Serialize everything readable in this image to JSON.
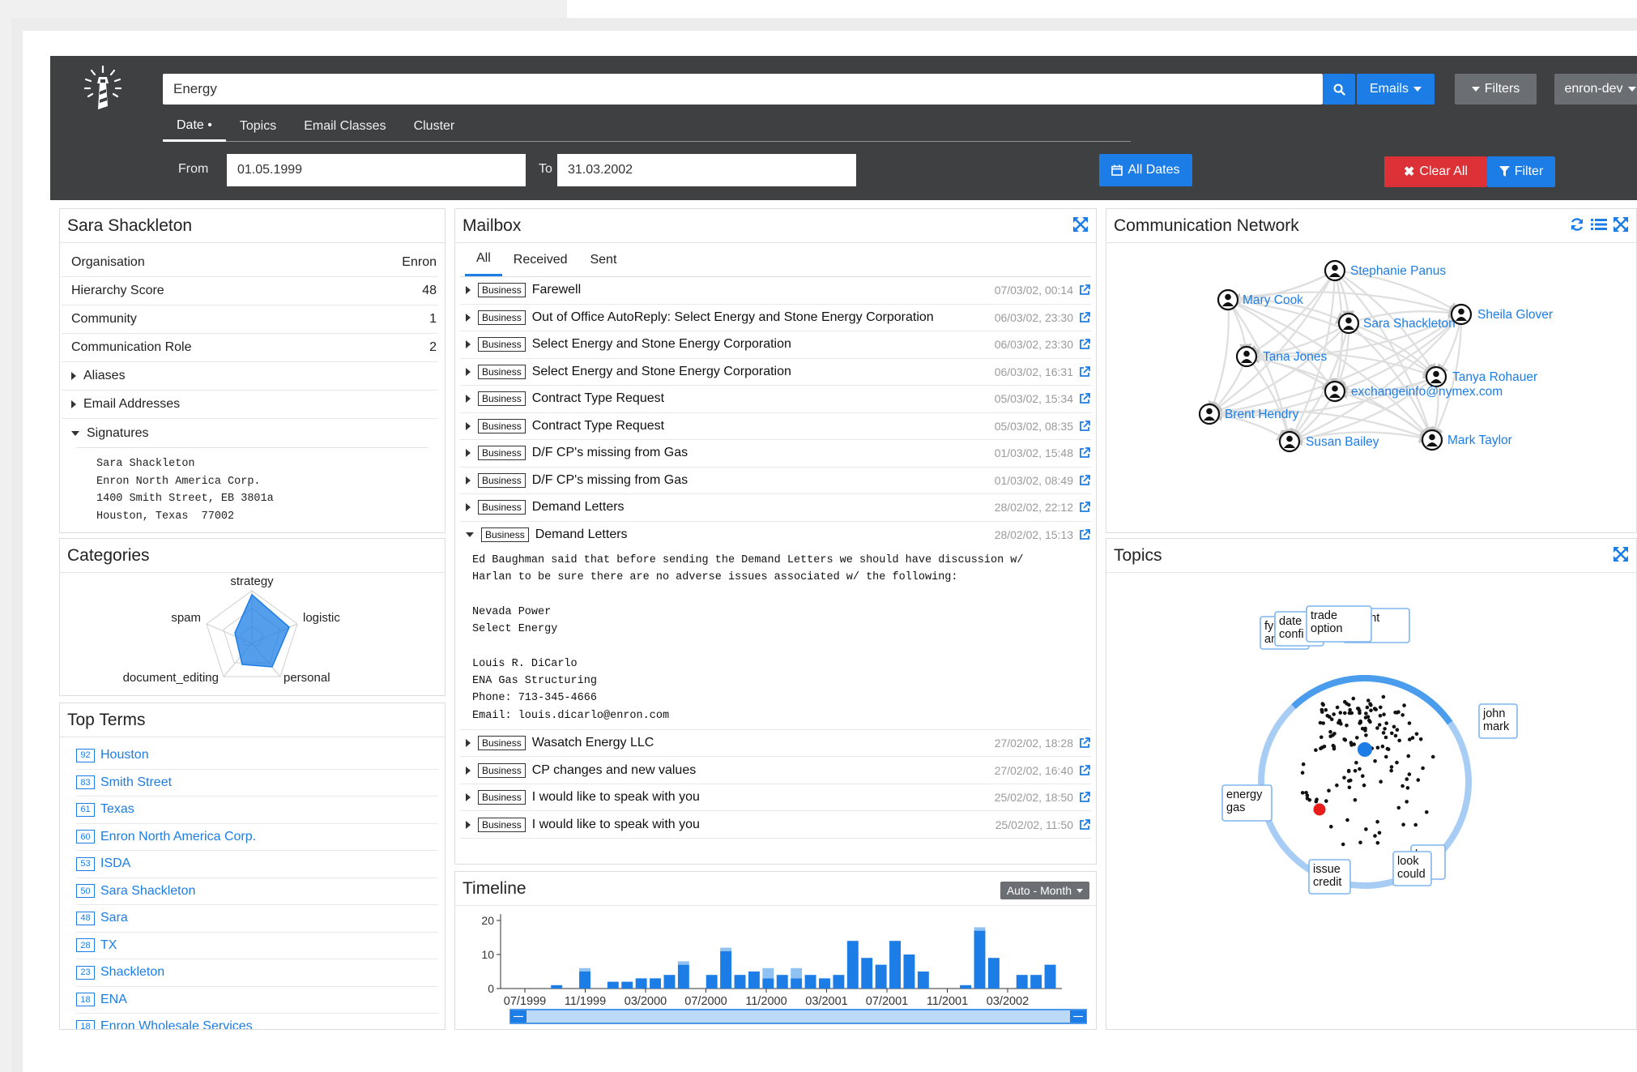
{
  "header": {
    "search_value": "Energy",
    "emails_label": "Emails",
    "filters_label": "Filters",
    "user_label": "enron-dev",
    "tabs": [
      {
        "label": "Date •"
      },
      {
        "label": "Topics"
      },
      {
        "label": "Email Classes"
      },
      {
        "label": "Cluster"
      }
    ],
    "from_label": "From",
    "from_value": "01.05.1999",
    "to_label": "To",
    "to_value": "31.03.2002",
    "all_dates_label": "All Dates",
    "clear_all_label": "Clear All",
    "filter_label": "Filter"
  },
  "person": {
    "title": "Sara Shackleton",
    "rows": [
      {
        "key": "Organisation",
        "value": "Enron"
      },
      {
        "key": "Hierarchy Score",
        "value": "48"
      },
      {
        "key": "Community",
        "value": "1"
      },
      {
        "key": "Communication Role",
        "value": "2"
      }
    ],
    "aliases_label": "Aliases",
    "email_addresses_label": "Email Addresses",
    "signatures_label": "Signatures",
    "signature_lines": [
      "Sara Shackleton",
      "Enron North America Corp.",
      "1400 Smith Street, EB 3801a",
      "Houston, Texas  77002"
    ]
  },
  "categories": {
    "title": "Categories",
    "labels": {
      "top": "strategy",
      "right": "logistic",
      "bottom_right": "personal",
      "bottom_left": "document_editing",
      "left": "spam"
    },
    "fill": "#1c7de6"
  },
  "top_terms": {
    "title": "Top Terms",
    "items": [
      {
        "count": "92",
        "label": "Houston"
      },
      {
        "count": "83",
        "label": "Smith Street"
      },
      {
        "count": "61",
        "label": "Texas"
      },
      {
        "count": "60",
        "label": "Enron North America Corp."
      },
      {
        "count": "53",
        "label": "ISDA"
      },
      {
        "count": "50",
        "label": "Sara Shackleton"
      },
      {
        "count": "48",
        "label": "Sara"
      },
      {
        "count": "28",
        "label": "TX"
      },
      {
        "count": "23",
        "label": "Shackleton"
      },
      {
        "count": "18",
        "label": "ENA"
      },
      {
        "count": "18",
        "label": "Enron Wholesale Services"
      }
    ]
  },
  "mailbox": {
    "title": "Mailbox",
    "tabs": [
      {
        "label": "All"
      },
      {
        "label": "Received"
      },
      {
        "label": "Sent"
      }
    ],
    "rows_top": [
      {
        "tag": "Business",
        "subject": "Farewell",
        "date": "07/03/02, 00:14"
      },
      {
        "tag": "Business",
        "subject": "Out of Office AutoReply: Select Energy and Stone Energy Corporation",
        "date": "06/03/02, 23:30"
      },
      {
        "tag": "Business",
        "subject": "Select Energy and Stone Energy Corporation",
        "date": "06/03/02, 23:30"
      },
      {
        "tag": "Business",
        "subject": "Select Energy and Stone Energy Corporation",
        "date": "06/03/02, 16:31"
      },
      {
        "tag": "Business",
        "subject": "Contract Type Request",
        "date": "05/03/02, 15:34"
      },
      {
        "tag": "Business",
        "subject": "Contract Type Request",
        "date": "05/03/02, 08:35"
      },
      {
        "tag": "Business",
        "subject": "D/F CP's missing from Gas",
        "date": "01/03/02, 15:48"
      },
      {
        "tag": "Business",
        "subject": "D/F CP's missing from Gas",
        "date": "01/03/02, 08:49"
      },
      {
        "tag": "Business",
        "subject": "Demand Letters",
        "date": "28/02/02, 22:12"
      }
    ],
    "open_row": {
      "tag": "Business",
      "subject": "Demand Letters",
      "date": "28/02/02, 15:13"
    },
    "open_body": [
      "Ed Baughman said that before sending the Demand Letters we should have discussion w/",
      "Harlan to be sure there are no adverse issues associated w/ the following:",
      "",
      "Nevada Power",
      "Select Energy",
      "",
      "Louis R. DiCarlo",
      "ENA Gas Structuring",
      "Phone: 713-345-4666",
      "Email: louis.dicarlo@enron.com"
    ],
    "rows_bottom": [
      {
        "tag": "Business",
        "subject": "Wasatch Energy LLC",
        "date": "27/02/02, 18:28"
      },
      {
        "tag": "Business",
        "subject": "CP changes and new values",
        "date": "27/02/02, 16:40"
      },
      {
        "tag": "Business",
        "subject": "I would like to speak with you",
        "date": "25/02/02, 18:50"
      },
      {
        "tag": "Business",
        "subject": "I would like to speak with you",
        "date": "25/02/02, 11:50"
      }
    ]
  },
  "timeline": {
    "title": "Timeline",
    "granularity_label": "Auto - Month"
  },
  "chart_data": {
    "type": "bar",
    "title": "Timeline",
    "xlabel": "",
    "ylabel": "",
    "ylim": [
      0,
      25
    ],
    "yticks": [
      0,
      10,
      20
    ],
    "x_tick_labels": [
      "07/1999",
      "11/1999",
      "03/2000",
      "07/2000",
      "11/2000",
      "03/2001",
      "07/2001",
      "11/2001",
      "03/2002"
    ],
    "categories": [
      "05/1999",
      "06/1999",
      "07/1999",
      "08/1999",
      "09/1999",
      "10/1999",
      "11/1999",
      "12/1999",
      "01/2000",
      "02/2000",
      "03/2000",
      "04/2000",
      "05/2000",
      "06/2000",
      "07/2000",
      "08/2000",
      "09/2000",
      "10/2000",
      "11/2000",
      "12/2000",
      "01/2001",
      "02/2001",
      "03/2001",
      "04/2001",
      "05/2001",
      "06/2001",
      "07/2001",
      "08/2001",
      "09/2001",
      "10/2001",
      "11/2001",
      "12/2001",
      "01/2002",
      "02/2002",
      "03/2002"
    ],
    "series": [
      {
        "values": [
          0,
          0,
          0,
          1,
          0,
          5,
          0,
          2,
          2,
          3,
          3,
          4,
          7,
          0,
          4,
          11,
          4,
          5,
          3,
          4,
          3,
          4,
          3,
          4,
          14,
          9,
          7,
          14,
          10,
          5,
          0,
          0,
          1,
          17,
          9,
          0,
          4,
          4,
          7
        ]
      },
      {
        "values": [
          0,
          0,
          0,
          0,
          0,
          1,
          0,
          0,
          0,
          0,
          0,
          0,
          1,
          0,
          0,
          1,
          0,
          0,
          3,
          0,
          3,
          0,
          0,
          0,
          0,
          0,
          0,
          0,
          0,
          0,
          0,
          0,
          0,
          1,
          0,
          0,
          0,
          0,
          0
        ]
      }
    ],
    "colors": {
      "primary": "#1c7de6",
      "secondary": "#8fc1f2"
    }
  },
  "network": {
    "title": "Communication Network",
    "nodes": [
      {
        "label": "Stephanie Panus"
      },
      {
        "label": "Mary Cook"
      },
      {
        "label": "Sara Shackleton"
      },
      {
        "label": "Sheila Glover"
      },
      {
        "label": "Tana Jones"
      },
      {
        "label": "Tanya Rohauer"
      },
      {
        "label": "exchangeinfo@nymex.com"
      },
      {
        "label": "Brent Hendry"
      },
      {
        "label": "Susan Bailey"
      },
      {
        "label": "Mark Taylor"
      }
    ]
  },
  "topics": {
    "title": "Topics",
    "labels": [
      {
        "lines": [
          "trade",
          "option"
        ]
      },
      {
        "lines": [
          "date",
          "confi"
        ]
      },
      {
        "lines": [
          "ement",
          "tract"
        ]
      },
      {
        "lines": [
          "john",
          "mark"
        ]
      },
      {
        "lines": [
          "energy",
          "gas"
        ]
      },
      {
        "lines": [
          "issue",
          "credit"
        ]
      },
      {
        "lines": [
          "look",
          "could"
        ]
      }
    ],
    "partial_texts": [
      "fyi",
      "anything",
      "k",
      "nt"
    ]
  }
}
